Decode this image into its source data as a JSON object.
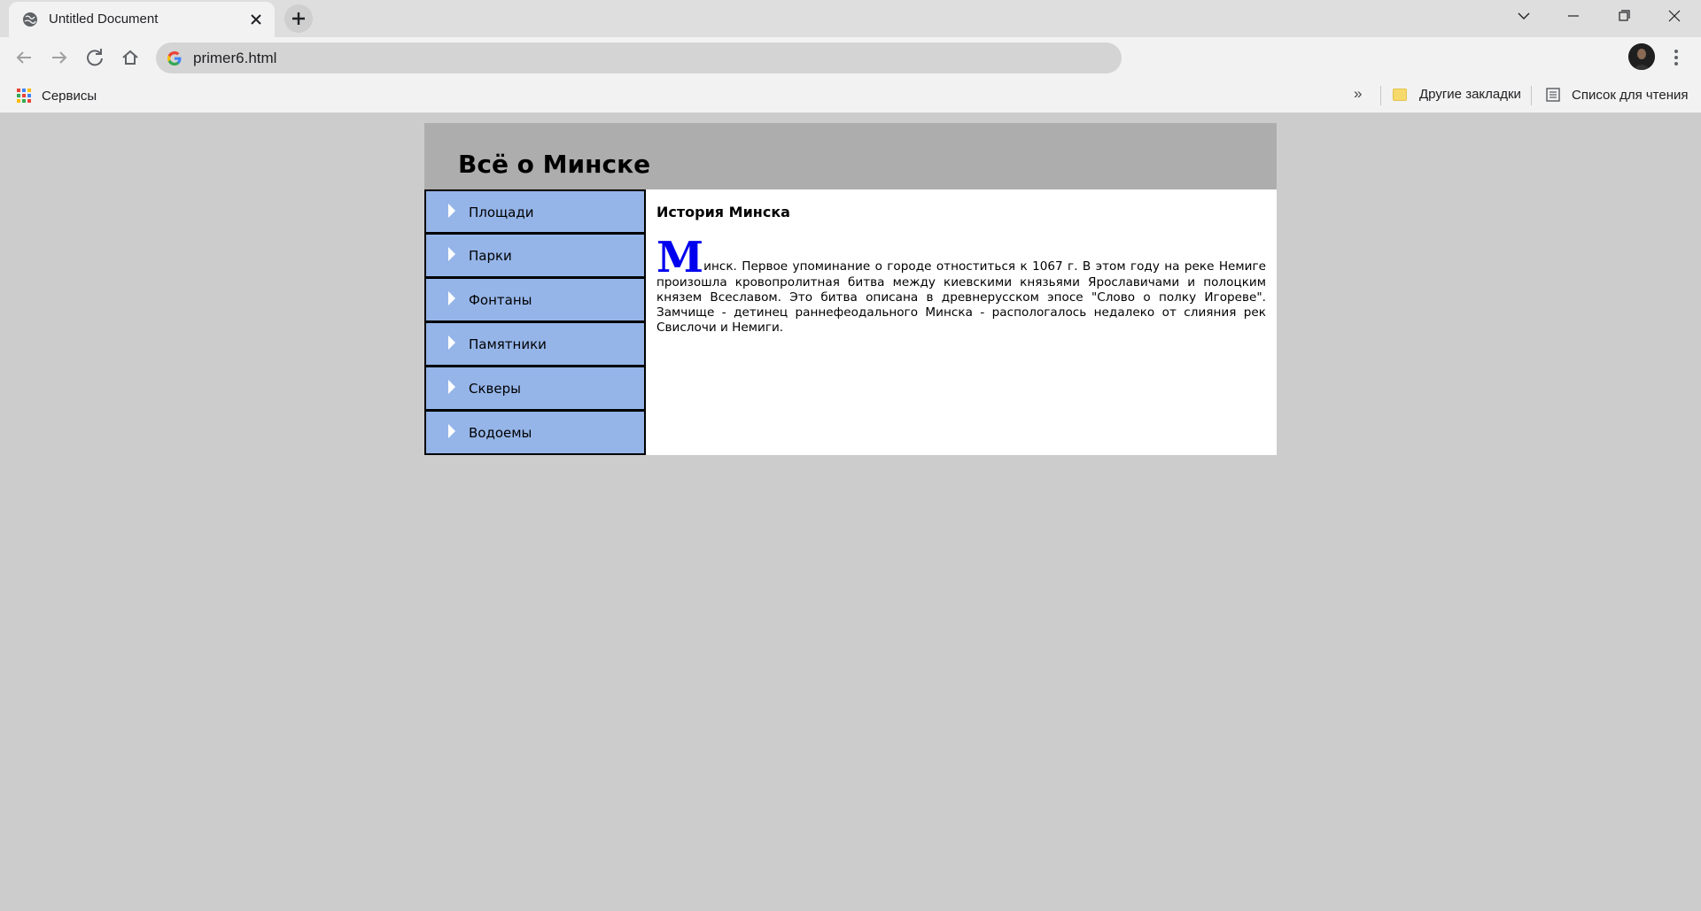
{
  "browser": {
    "tab": {
      "title": "Untitled Document",
      "favicon": "globe-icon"
    },
    "address_bar": {
      "url": "primer6.html",
      "icon": "google-g-icon"
    },
    "bookmarks": {
      "apps_label": "Сервисы",
      "more_label": "»",
      "other_label": "Другие закладки",
      "reading_list_label": "Список для чтения"
    }
  },
  "page": {
    "title": "Всё о Минске",
    "menu": [
      {
        "label": "Площади"
      },
      {
        "label": "Парки"
      },
      {
        "label": "Фонтаны"
      },
      {
        "label": "Памятники"
      },
      {
        "label": "Скверы"
      },
      {
        "label": "Водоемы"
      }
    ],
    "content": {
      "heading": "История Минска",
      "dropcap": "М",
      "text": "инск. Первое упоминание о городе отноститься к 1067 г. В этом году на реке Немиге произошла кровопролитная битва между киевскими князьями Ярославичами и полоцким князем Всеславом. Это битва описана в древнерусском эпосе \"Слово о полку Игореве\". Замчище - детинец раннефеодального Минска - распологалось недалеко от слияния рек Свислочи и Немиги."
    }
  },
  "colors": {
    "page_bg": "#cccccc",
    "header_bg": "#adadad",
    "menu_bg": "#95b5e9",
    "dropcap": "#0000ee"
  }
}
